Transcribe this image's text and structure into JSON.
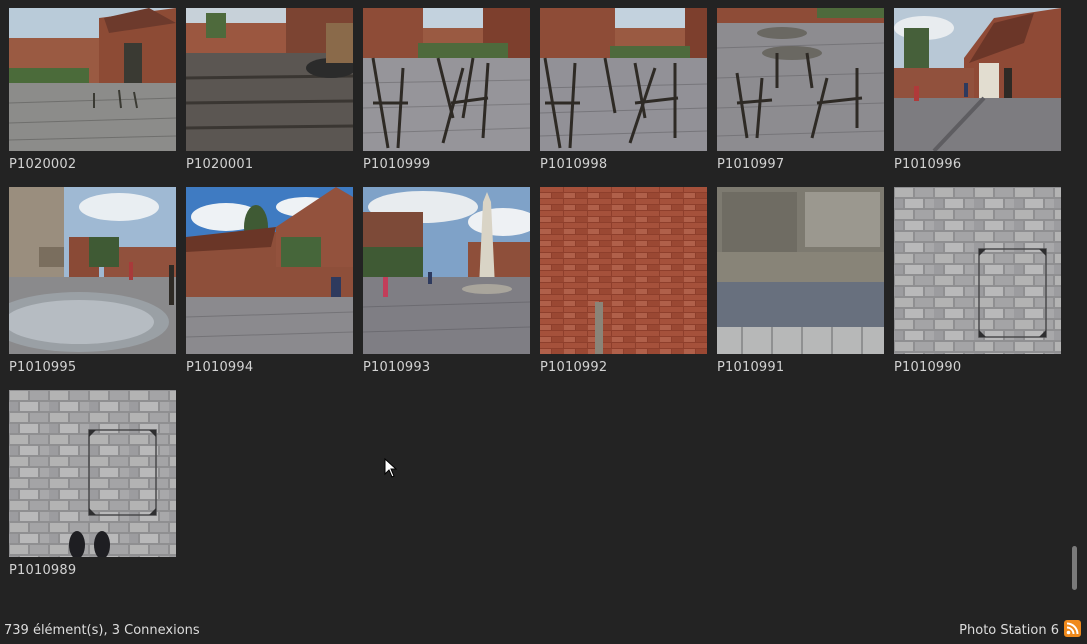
{
  "gallery": {
    "items": [
      {
        "name": "P1020002"
      },
      {
        "name": "P1020001"
      },
      {
        "name": "P1010999"
      },
      {
        "name": "P1010998"
      },
      {
        "name": "P1010997"
      },
      {
        "name": "P1010996"
      },
      {
        "name": "P1010995"
      },
      {
        "name": "P1010994"
      },
      {
        "name": "P1010993"
      },
      {
        "name": "P1010992"
      },
      {
        "name": "P1010991"
      },
      {
        "name": "P1010990"
      },
      {
        "name": "P1010989"
      }
    ]
  },
  "status": {
    "summary": "739 élément(s), 3 Connexions",
    "app_name": "Photo Station 6",
    "feed_icon": "rss-icon"
  },
  "colors": {
    "background": "#232323",
    "rss": "#f08a1c"
  }
}
